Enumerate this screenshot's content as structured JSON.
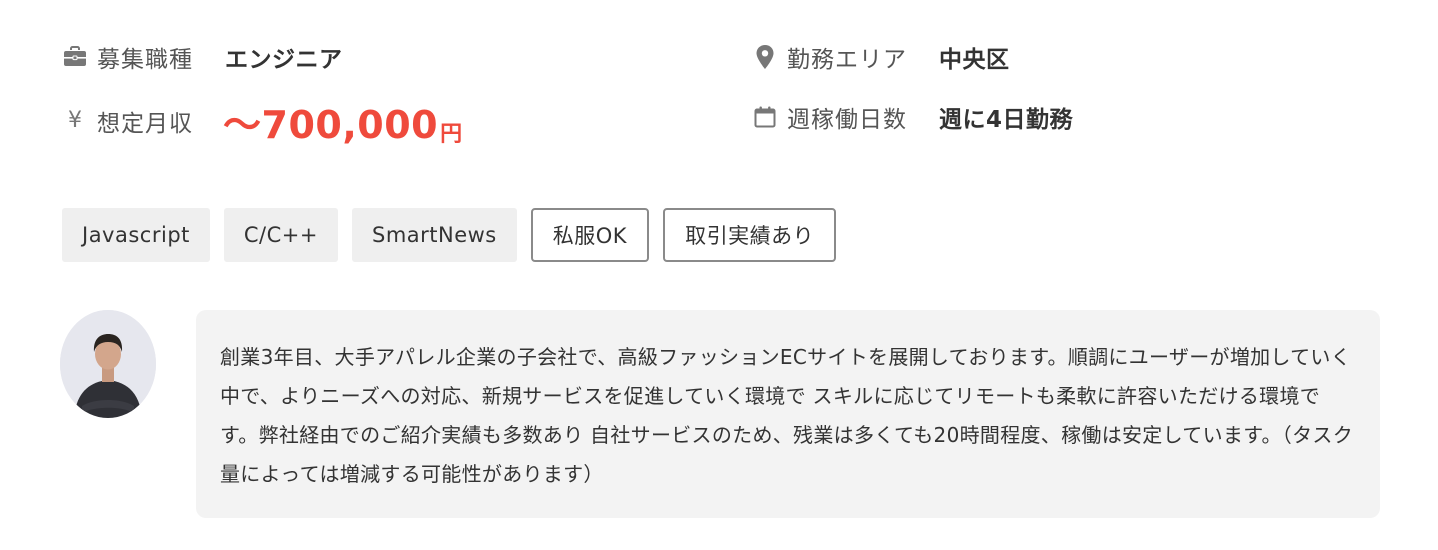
{
  "job_info": {
    "position": {
      "icon": "briefcase-icon",
      "label": "募集職種",
      "value": "エンジニア"
    },
    "location": {
      "icon": "location-pin-icon",
      "label": "勤務エリア",
      "value": "中央区"
    },
    "salary": {
      "icon": "yen-icon",
      "icon_glyph": "¥",
      "label": "想定月収",
      "amount": "〜700,000",
      "unit": "円"
    },
    "workdays": {
      "icon": "calendar-icon",
      "label": "週稼働日数",
      "value": "週に4日勤務"
    }
  },
  "tags": [
    {
      "label": "Javascript",
      "style": "filled"
    },
    {
      "label": "C/C++",
      "style": "filled"
    },
    {
      "label": "SmartNews",
      "style": "filled"
    },
    {
      "label": "私服OK",
      "style": "outline"
    },
    {
      "label": "取引実績あり",
      "style": "outline"
    }
  ],
  "comment": {
    "text": "創業3年目、大手アパレル企業の子会社で、高級ファッションECサイトを展開しております。順調にユーザーが増加していく中で、よりニーズへの対応、新規サービスを促進していく環境で スキルに応じてリモートも柔軟に許容いただける環境です。弊社経由でのご紹介実績も多数あり 自社サービスのため、残業は多くても20時間程度、稼働は安定しています。（タスク量によっては増減する可能性があります）"
  },
  "colors": {
    "accent": "#ef4a3c",
    "text": "#333333",
    "label": "#555555",
    "icon": "#777777",
    "tag_fill": "#efefef",
    "tag_border": "#8a8a8a",
    "comment_bg": "#f3f3f3"
  }
}
